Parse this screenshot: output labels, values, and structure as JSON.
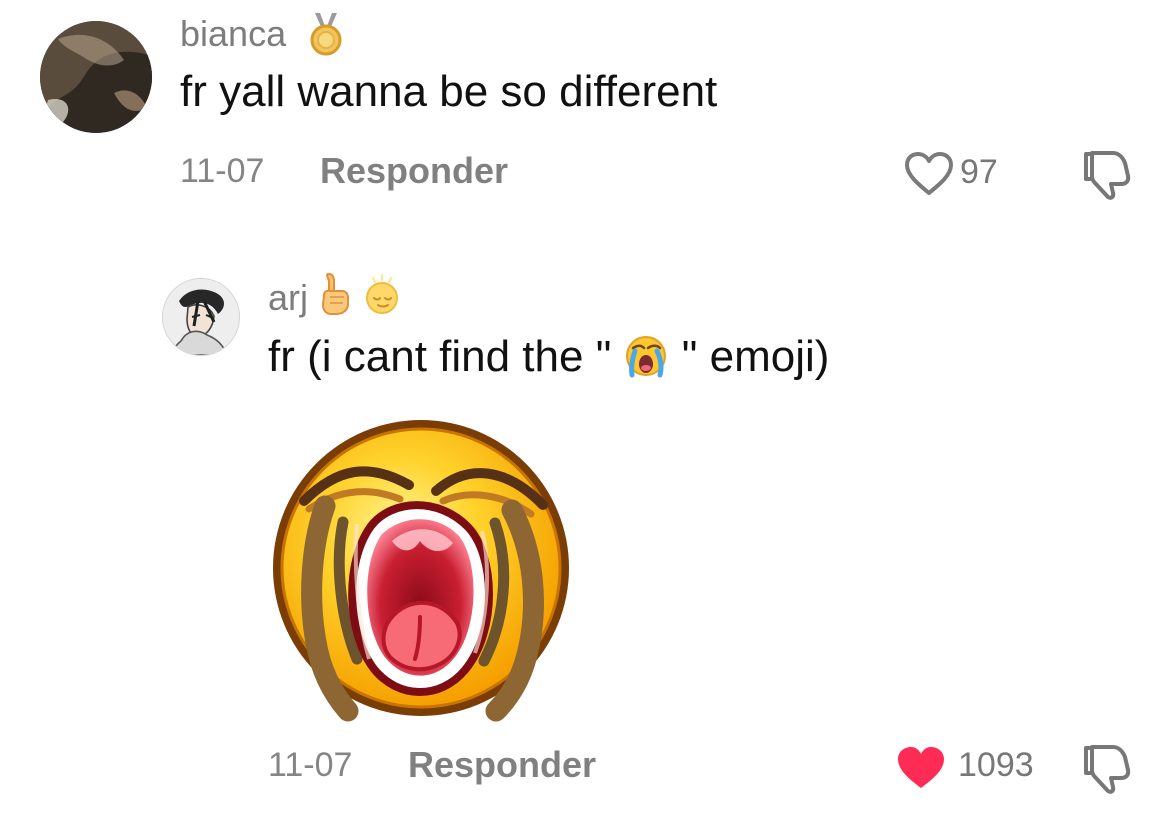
{
  "comments": [
    {
      "username": "bianca",
      "badge_icon": "medal-icon",
      "text": "fr yall wanna be so different",
      "date": "11-07",
      "reply_label": "Responder",
      "likes": "97",
      "liked": false,
      "avatar_icon": "user-avatar"
    },
    {
      "username": "arj",
      "badge_icons": [
        "pointing-up-icon",
        "sleepy-face-icon"
      ],
      "text_before": "fr (i cant find the \"",
      "text_emoji": "loudly-crying-face-icon",
      "text_after": "\" emoji)",
      "sticker_icon": "crying-face-sticker",
      "date": "11-07",
      "reply_label": "Responder",
      "likes": "1093",
      "liked": true,
      "avatar_icon": "user-avatar"
    }
  ],
  "colors": {
    "background": "#ffffff",
    "muted_text": "#808080",
    "body_text": "#111111",
    "liked_heart": "#fe2c55",
    "emoji_yellow": "#ffc21a"
  }
}
